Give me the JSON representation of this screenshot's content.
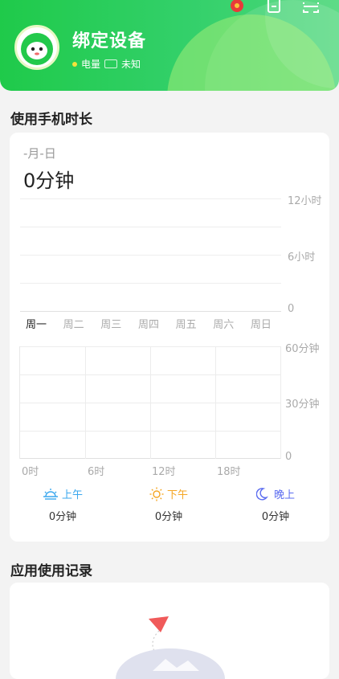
{
  "header": {
    "device_title": "绑定设备",
    "battery_label": "电量",
    "battery_value": "未知",
    "icons": [
      "red-envelope-icon",
      "document-icon",
      "scan-icon"
    ],
    "colors": {
      "green": "#22c94b",
      "yellow_dot": "#f5e33a"
    }
  },
  "usage_section": {
    "title": "使用手机时长",
    "date": "-月-日",
    "total": "0分钟",
    "weekly_y_labels": [
      "12小时",
      "6小时",
      "0"
    ],
    "weekdays": [
      "周一",
      "周二",
      "周三",
      "周四",
      "周五",
      "周六",
      "周日"
    ],
    "selected_weekday": "周一",
    "daily_y_labels": [
      "60分钟",
      "30分钟",
      "0"
    ],
    "daily_x_labels": [
      "0时",
      "6时",
      "12时",
      "18时"
    ],
    "periods": [
      {
        "label": "上午",
        "value": "0分钟",
        "color": "#3aa7ee",
        "icon": "sunrise-icon"
      },
      {
        "label": "下午",
        "value": "0分钟",
        "color": "#f5a623",
        "icon": "sun-icon"
      },
      {
        "label": "晚上",
        "value": "0分钟",
        "color": "#5b6cf0",
        "icon": "moon-icon"
      }
    ]
  },
  "app_section": {
    "title": "应用使用记录"
  }
}
